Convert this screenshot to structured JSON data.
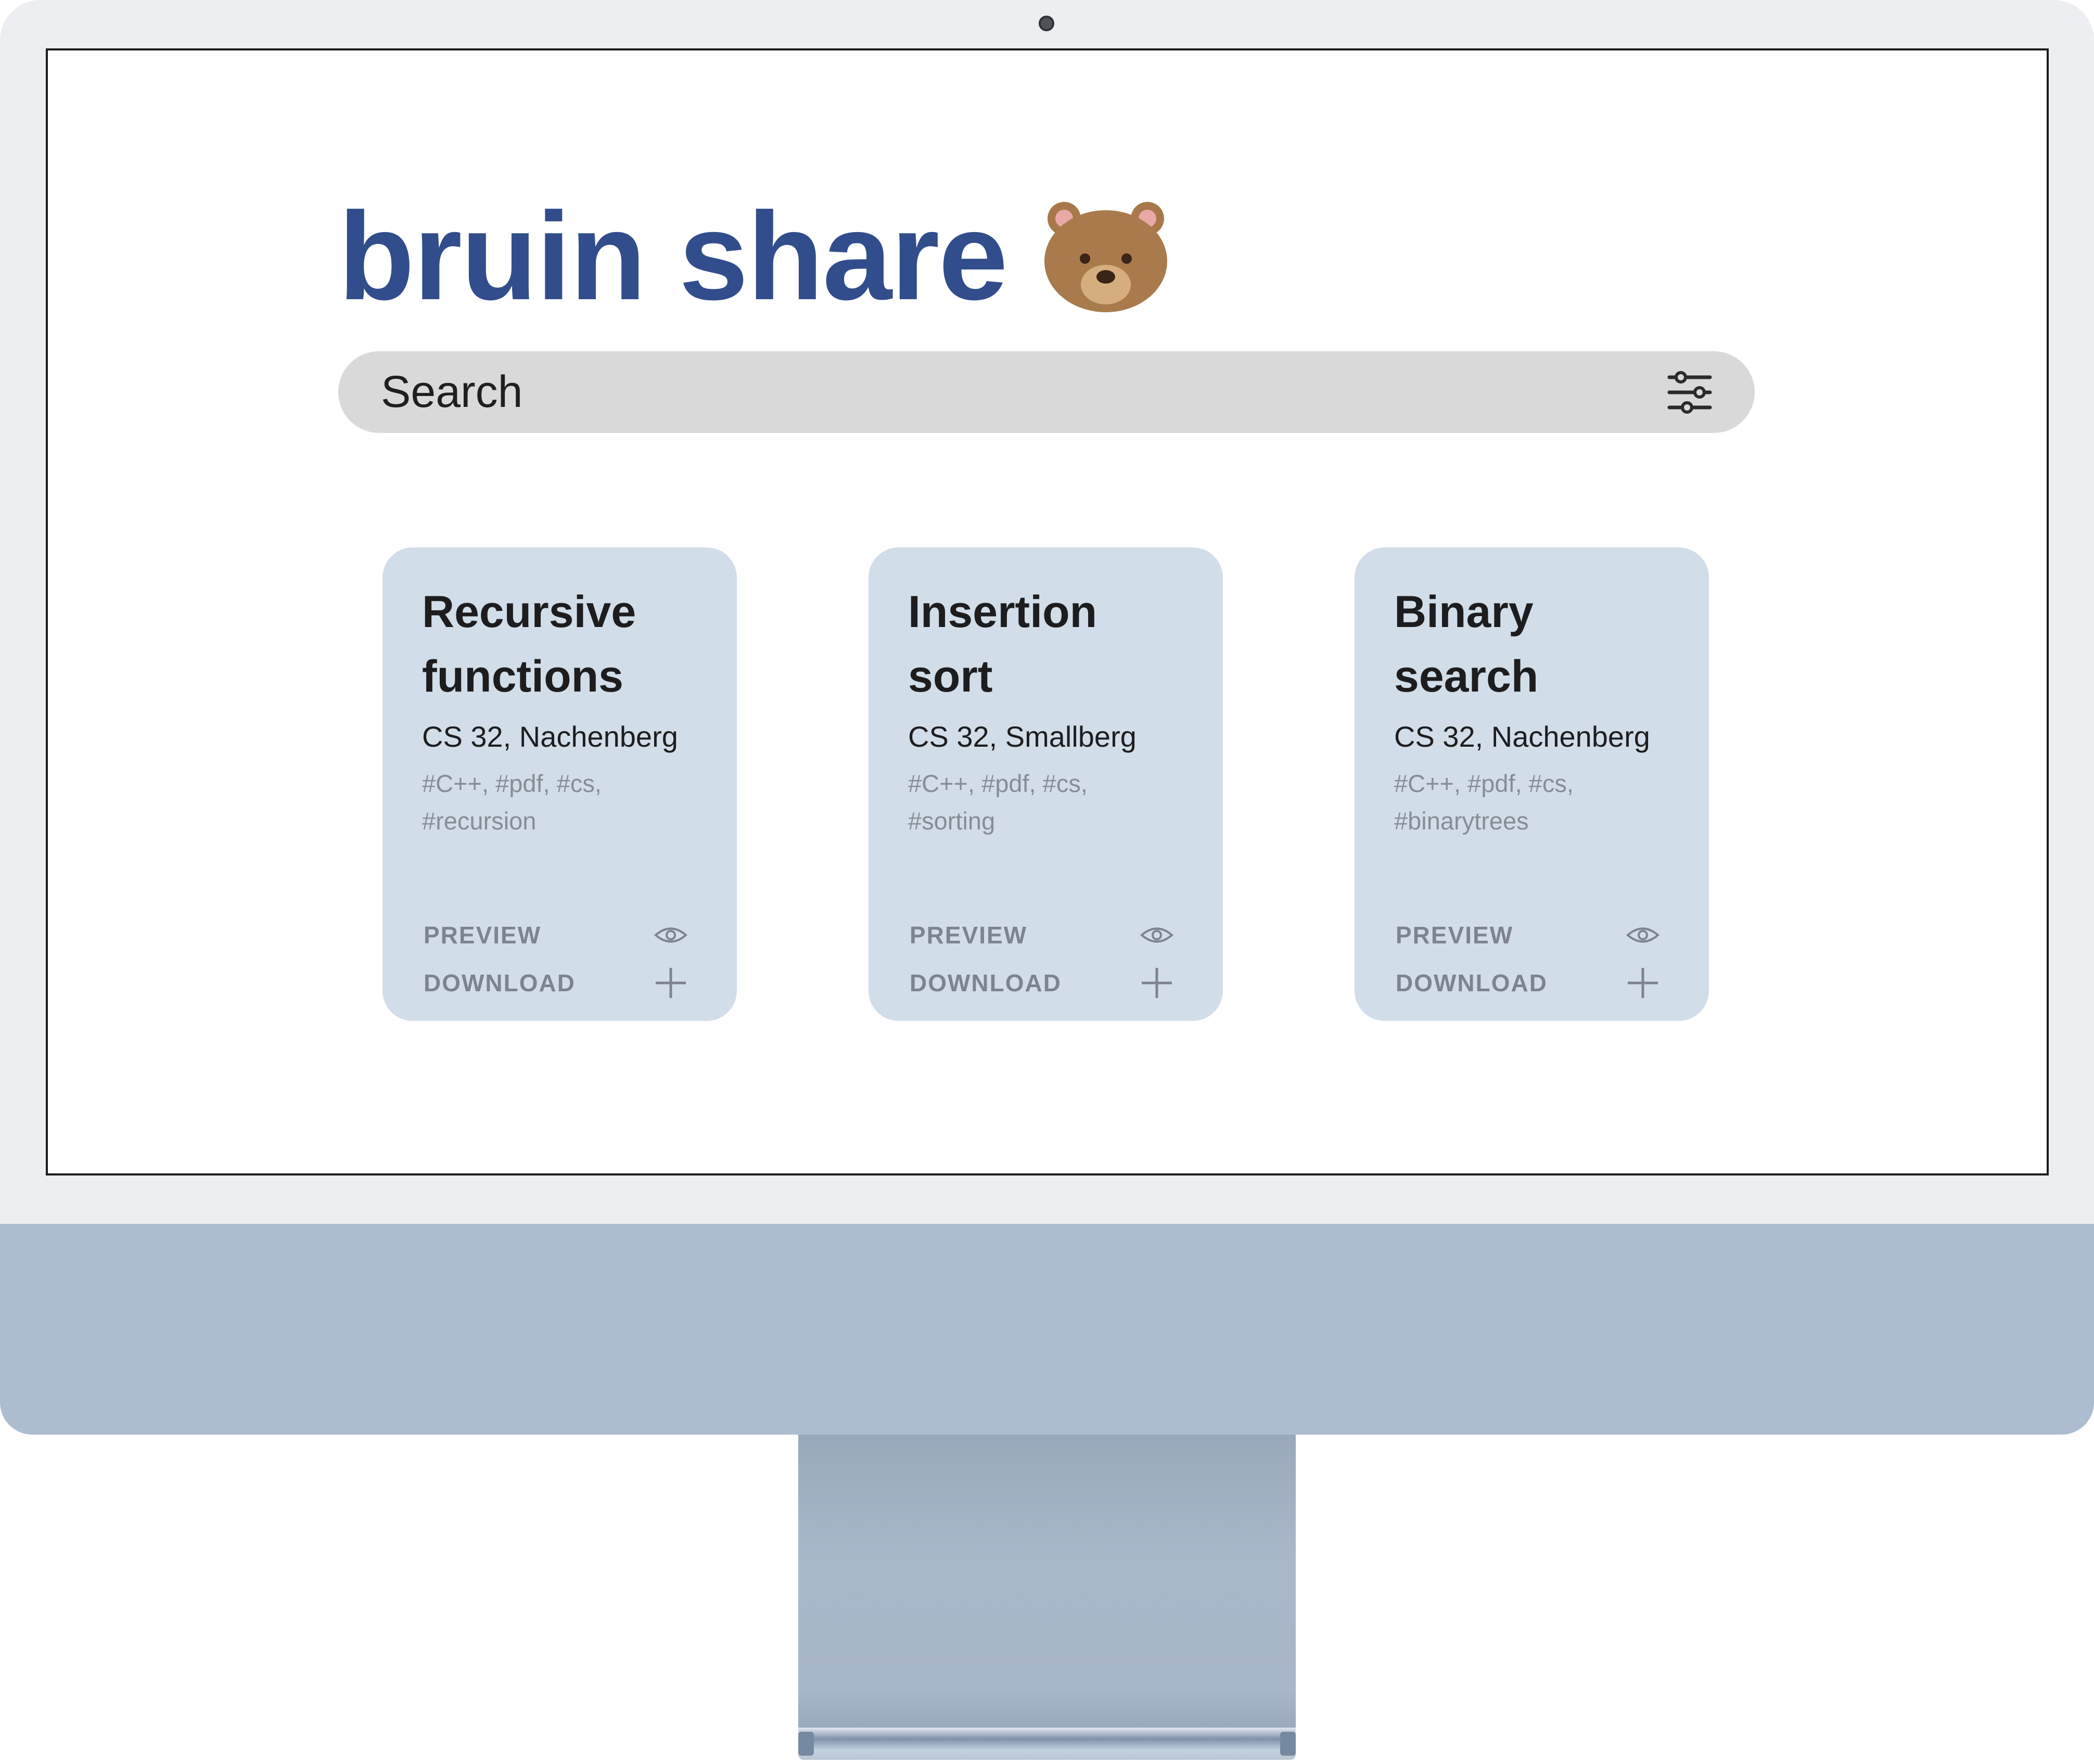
{
  "app": {
    "title": "bruin share",
    "logo_icon": "bear-face-icon"
  },
  "search": {
    "placeholder": "Search",
    "filter_icon": "sliders-filter-icon"
  },
  "cards": [
    {
      "title": "Recursive functions",
      "course": "CS 32, Nachenberg",
      "tags": "#C++, #pdf, #cs, #recursion",
      "preview_label": "PREVIEW",
      "download_label": "DOWNLOAD"
    },
    {
      "title": "Insertion sort",
      "course": "CS 32, Smallberg",
      "tags": "#C++, #pdf, #cs, #sorting",
      "preview_label": "PREVIEW",
      "download_label": "DOWNLOAD"
    },
    {
      "title": "Binary search",
      "course": "CS 32, Nachenberg",
      "tags": "#C++, #pdf, #cs, #binarytrees",
      "preview_label": "PREVIEW",
      "download_label": "DOWNLOAD"
    }
  ],
  "icons": {
    "preview": "eye-icon",
    "download": "plus-icon"
  },
  "colors": {
    "brand_title": "#324d8c",
    "card_background": "#d1dee9",
    "search_background": "#d9d9d9",
    "device_frame": "#eceef1",
    "device_chin": "#adbdd0"
  }
}
